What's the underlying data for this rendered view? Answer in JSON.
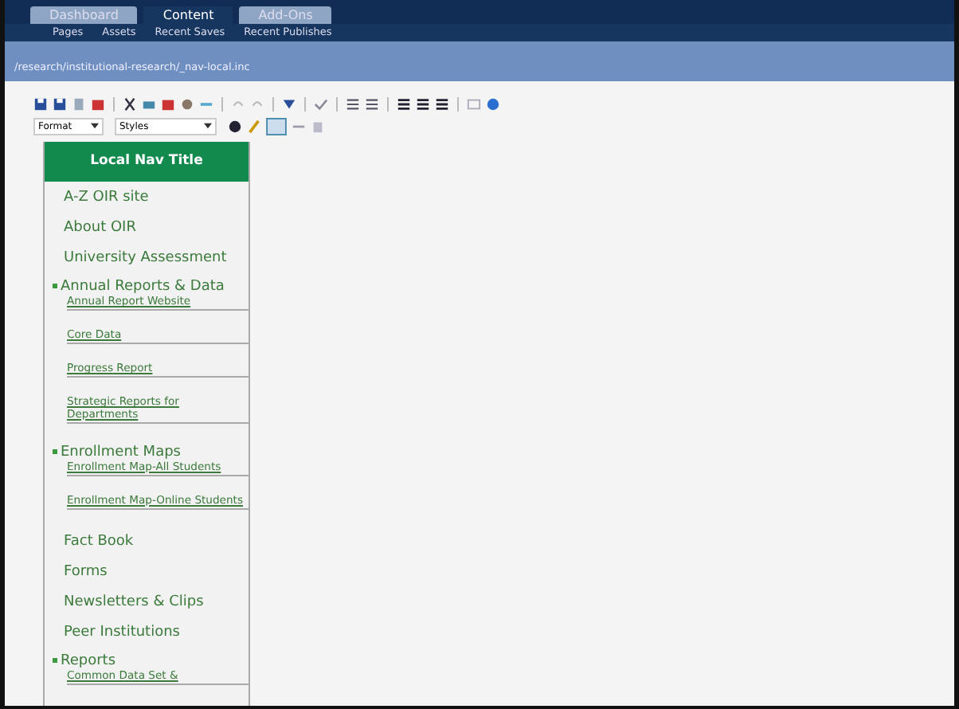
{
  "tabs": [
    {
      "label": "Dashboard",
      "selected": false
    },
    {
      "label": "Content",
      "selected": true
    },
    {
      "label": "Add-Ons",
      "selected": false
    }
  ],
  "subnav": [
    "Pages",
    "Assets",
    "Recent Saves",
    "Recent Publishes"
  ],
  "path": "/research/institutional-research/_nav-local.inc",
  "toolbar": {
    "format": "Format",
    "styles": "Styles"
  },
  "nav": {
    "title": "Local Nav Title",
    "items": [
      {
        "kind": "link",
        "label": "A-Z OIR site"
      },
      {
        "kind": "link",
        "label": "About OIR"
      },
      {
        "kind": "link",
        "label": "University Assessment"
      },
      {
        "kind": "group",
        "label": "Annual Reports & Data",
        "children": [
          "Annual Report Website",
          "Core Data",
          "Progress Report",
          "Strategic Reports for Departments"
        ]
      },
      {
        "kind": "group",
        "label": "Enrollment Maps",
        "children": [
          "Enrollment Map-All Students",
          "Enrollment Map-Online Students"
        ]
      },
      {
        "kind": "link",
        "label": "Fact Book"
      },
      {
        "kind": "link",
        "label": "Forms"
      },
      {
        "kind": "link",
        "label": "Newsletters & Clips"
      },
      {
        "kind": "link",
        "label": "Peer Institutions"
      },
      {
        "kind": "group",
        "label": "Reports",
        "children": [
          "Common Data Set &"
        ]
      }
    ]
  }
}
